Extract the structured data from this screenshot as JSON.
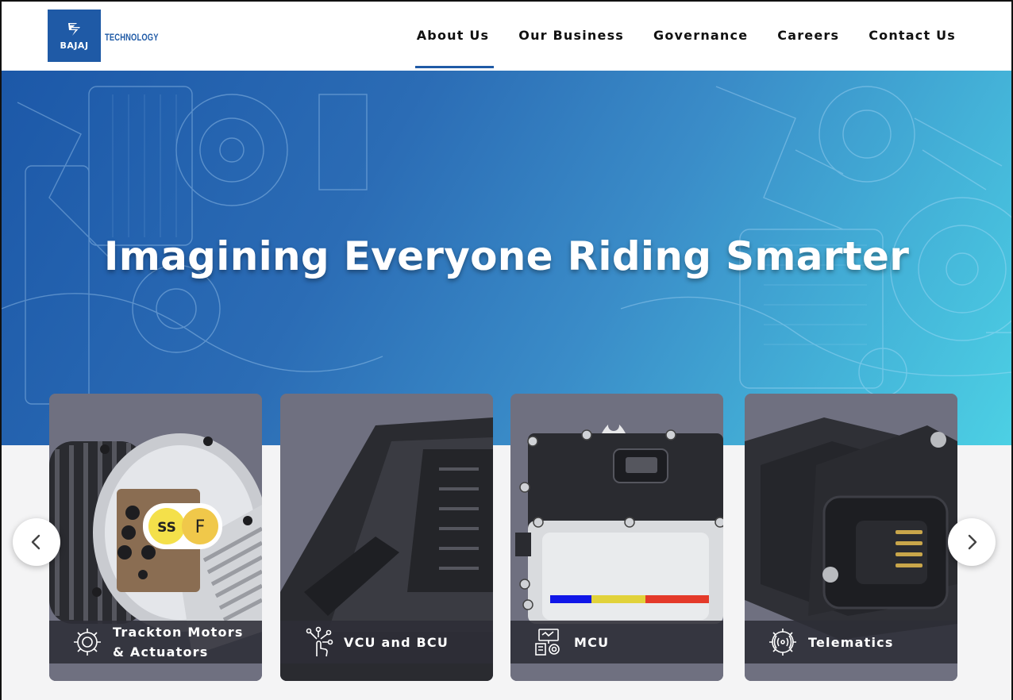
{
  "brand": {
    "name": "BAJAJ",
    "subtitle": "TECHNOLOGY",
    "color": "#1f5aa6"
  },
  "nav": {
    "items": [
      {
        "label": "About Us",
        "active": true
      },
      {
        "label": "Our Business",
        "active": false
      },
      {
        "label": "Governance",
        "active": false
      },
      {
        "label": "Careers",
        "active": false
      },
      {
        "label": "Contact Us",
        "active": false
      }
    ]
  },
  "hero": {
    "title": "Imagining Everyone Riding Smarter"
  },
  "cards": [
    {
      "label_line1": "Trackton Motors",
      "label_line2": "& Actuators",
      "icon": "motor-gear-icon"
    },
    {
      "label_line1": "VCU and BCU",
      "label_line2": "",
      "icon": "touch-network-icon"
    },
    {
      "label_line1": "MCU",
      "label_line2": "",
      "icon": "controller-chip-icon"
    },
    {
      "label_line1": "Telematics",
      "label_line2": "",
      "icon": "wireless-gear-icon"
    }
  ],
  "motor_badge": {
    "left": "SS",
    "right": "F"
  },
  "carousel": {
    "prev_icon": "chevron-left-icon",
    "next_icon": "chevron-right-icon"
  }
}
